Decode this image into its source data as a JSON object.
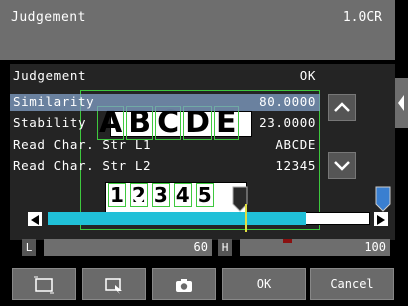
{
  "header": {
    "title": "Judgement",
    "right_label": "1.0CR"
  },
  "results": [
    {
      "label": "Judgement",
      "value": "OK"
    },
    {
      "label": "Similarity",
      "value": "80.0000"
    },
    {
      "label": "Stability",
      "value": "23.0000"
    },
    {
      "label": "Read Char. Str L1",
      "value": "ABCDE"
    },
    {
      "label": "Read Char. Str L2",
      "value": "12345"
    }
  ],
  "image": {
    "line1_chars": [
      "A",
      "B",
      "C",
      "D",
      "E"
    ],
    "line2_chars": [
      "1",
      "2",
      "3",
      "4",
      "5"
    ]
  },
  "threshold": {
    "low_tag": "L",
    "low_value": "60",
    "high_tag": "H",
    "high_value": "100",
    "fill_fraction": 0.8
  },
  "buttons": {
    "ok": "OK",
    "cancel": "Cancel"
  },
  "icons": {
    "arrow_up": "chevron-up-icon",
    "arrow_down": "chevron-down-icon",
    "side": "chevron-left-icon",
    "frame": "frame-icon",
    "zoom": "zoom-select-icon",
    "camera": "camera-icon"
  },
  "colors": {
    "accent": "#20c0d8",
    "roi": "#3ec83e",
    "highlight": "#82a0c8"
  }
}
